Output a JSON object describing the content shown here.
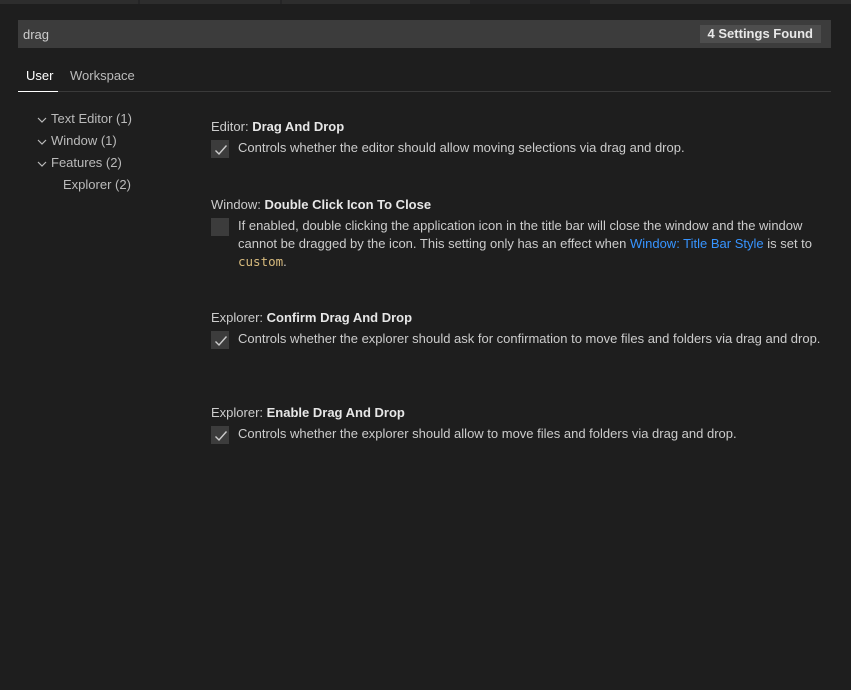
{
  "search": {
    "value": "drag",
    "result_count": "4 Settings Found"
  },
  "scope_tabs": [
    {
      "label": "User",
      "active": true
    },
    {
      "label": "Workspace",
      "active": false
    }
  ],
  "toc": [
    {
      "label": "Text Editor (1)"
    },
    {
      "label": "Window (1)"
    },
    {
      "label": "Features (2)"
    },
    {
      "label": "Explorer (2)"
    }
  ],
  "settings": [
    {
      "category": "Editor: ",
      "name": "Drag And Drop",
      "checked": true,
      "description": "Controls whether the editor should allow moving selections via drag and drop."
    },
    {
      "category": "Window: ",
      "name": "Double Click Icon To Close",
      "checked": false,
      "description_before_link": "If enabled, double clicking the application icon in the title bar will close the window and the window cannot be dragged by the icon. This setting only has an effect when ",
      "link_text": "Window: Title Bar Style",
      "description_mid": " is set to ",
      "code_text": "custom",
      "description_end": "."
    },
    {
      "category": "Explorer: ",
      "name": "Confirm Drag And Drop",
      "checked": true,
      "description": "Controls whether the explorer should ask for confirmation to move files and folders via drag and drop."
    },
    {
      "category": "Explorer: ",
      "name": "Enable Drag And Drop",
      "checked": true,
      "description": "Controls whether the explorer should allow to move files and folders via drag and drop."
    }
  ],
  "colors": {
    "background": "#1e1e1e",
    "link": "#3794ff",
    "code": "#d7ba7d",
    "input_bg": "#3c3c3c"
  }
}
